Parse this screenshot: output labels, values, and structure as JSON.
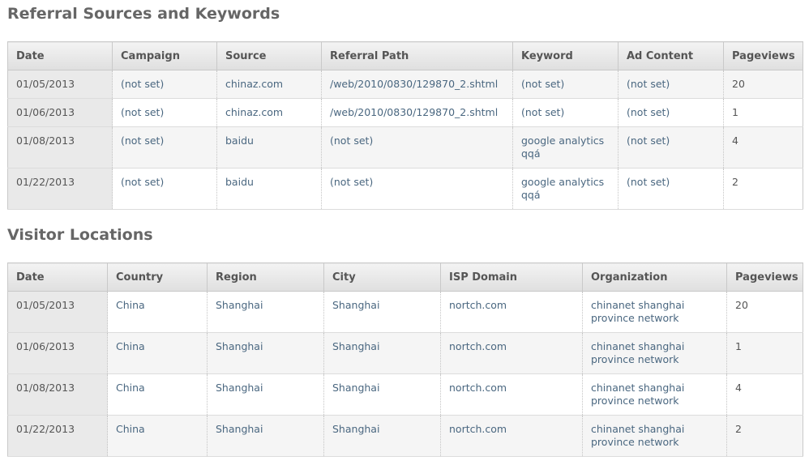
{
  "referral": {
    "title": "Referral Sources and Keywords",
    "columns": [
      "Date",
      "Campaign",
      "Source",
      "Referral Path",
      "Keyword",
      "Ad Content",
      "Pageviews"
    ],
    "rows": [
      [
        "01/05/2013",
        "(not set)",
        "chinaz.com",
        "/web/2010/0830/129870_2.shtml",
        "(not set)",
        "(not set)",
        "20"
      ],
      [
        "01/06/2013",
        "(not set)",
        "chinaz.com",
        "/web/2010/0830/129870_2.shtml",
        "(not set)",
        "(not set)",
        "1"
      ],
      [
        "01/08/2013",
        "(not set)",
        "baidu",
        "(not set)",
        "google analytics qqа́",
        "(not set)",
        "4"
      ],
      [
        "01/22/2013",
        "(not set)",
        "baidu",
        "(not set)",
        "google analytics qqа́",
        "(not set)",
        "2"
      ]
    ]
  },
  "locations": {
    "title": "Visitor Locations",
    "columns": [
      "Date",
      "Country",
      "Region",
      "City",
      "ISP Domain",
      "Organization",
      "Pageviews"
    ],
    "rows": [
      [
        "01/05/2013",
        "China",
        "Shanghai",
        "Shanghai",
        "nortch.com",
        "chinanet shanghai province network",
        "20"
      ],
      [
        "01/06/2013",
        "China",
        "Shanghai",
        "Shanghai",
        "nortch.com",
        "chinanet shanghai province network",
        "1"
      ],
      [
        "01/08/2013",
        "China",
        "Shanghai",
        "Shanghai",
        "nortch.com",
        "chinanet shanghai province network",
        "4"
      ],
      [
        "01/22/2013",
        "China",
        "Shanghai",
        "Shanghai",
        "nortch.com",
        "chinanet shanghai province network",
        "2"
      ]
    ]
  }
}
